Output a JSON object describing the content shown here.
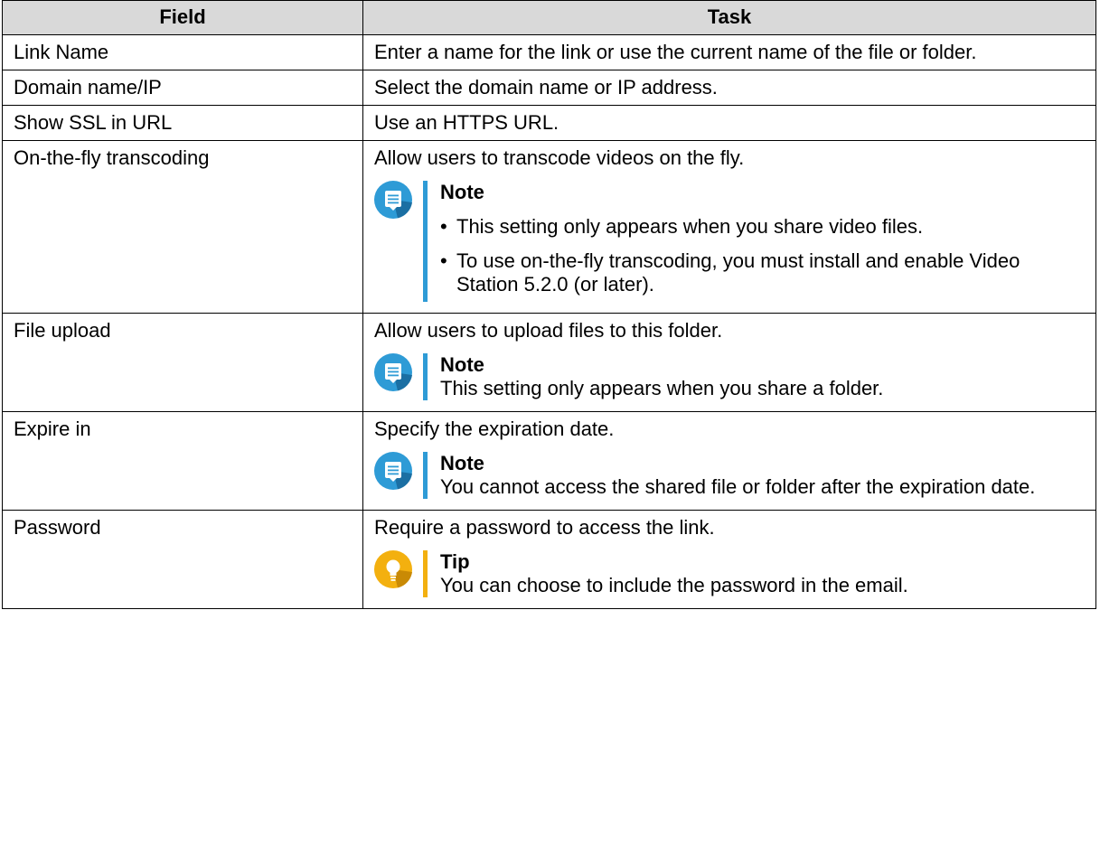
{
  "table": {
    "headers": [
      "Field",
      "Task"
    ],
    "rows": [
      {
        "field": "Link Name",
        "task": "Enter a name for the link or use the current name of the file or folder."
      },
      {
        "field": "Domain name/IP",
        "task": "Select the domain name or IP address."
      },
      {
        "field": "Show SSL in URL",
        "task": "Use an HTTPS URL."
      },
      {
        "field": "On-the-fly transcoding",
        "task": "Allow users to transcode videos on the fly.",
        "note": {
          "title": "Note",
          "items": [
            "This setting only appears when you share video files.",
            "To use on-the-fly transcoding, you must install and enable Video Station 5.2.0 (or later)."
          ]
        }
      },
      {
        "field": "File upload",
        "task": "Allow users to upload files to this folder.",
        "note": {
          "title": "Note",
          "text": "This setting only appears when you share a folder."
        }
      },
      {
        "field": "Expire in",
        "task": "Specify the expiration date.",
        "note": {
          "title": "Note",
          "text": "You cannot access the shared file or folder after the expiration date."
        }
      },
      {
        "field": "Password",
        "task": "Require a password to access the link.",
        "tip": {
          "title": "Tip",
          "text": "You can choose to include the password in the email."
        }
      }
    ]
  },
  "colors": {
    "header_bg": "#d9d9d9",
    "note_accent": "#2e9bd6",
    "tip_accent": "#f3b00f"
  },
  "icons": {
    "note": "note-icon",
    "tip": "lightbulb-icon"
  }
}
